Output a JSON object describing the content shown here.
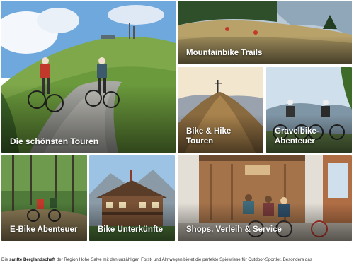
{
  "tiles": [
    {
      "id": "touren",
      "label": "Die schönsten Touren"
    },
    {
      "id": "mtb",
      "label": "Mountainbike Trails"
    },
    {
      "id": "hike",
      "label": "Bike & Hike Touren"
    },
    {
      "id": "gravel",
      "label": "Gravelbike-Abenteuer"
    },
    {
      "id": "ebike",
      "label": "E-Bike Abenteuer"
    },
    {
      "id": "unterkunft",
      "label": "Bike Unterkünfte"
    },
    {
      "id": "shops",
      "label": "Shops, Verleih & Service"
    }
  ],
  "description": {
    "prefix": "Die ",
    "highlight": "sanfte Berglandschaft",
    "rest": " der Region Hohe Salve mit den unzähligen Forst- und Almwegen bietet die perfekte Spielwiese für Outdoor-Sportler. Besonders das"
  },
  "colors": {
    "overlay_text": "#ffffff",
    "body_text": "#333333"
  }
}
